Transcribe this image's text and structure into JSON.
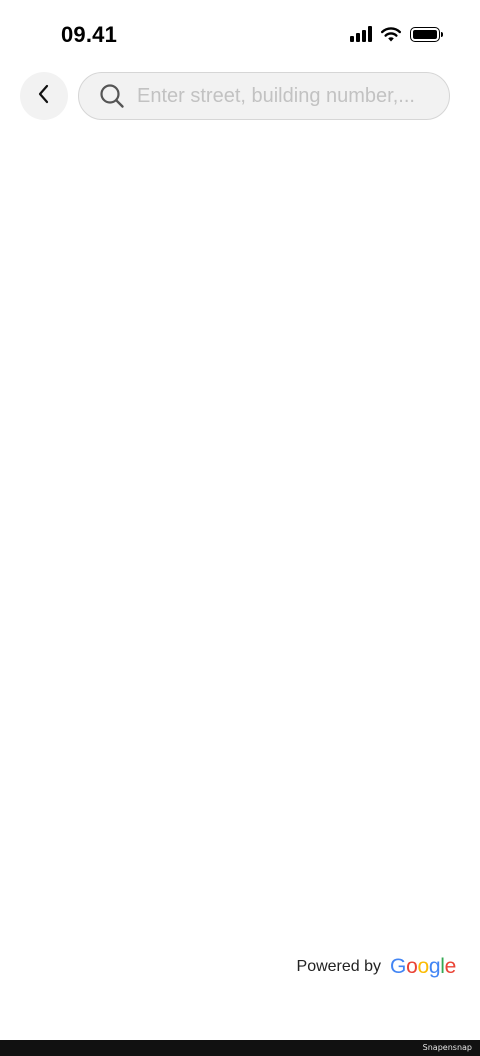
{
  "status_bar": {
    "time": "09.41",
    "icons": [
      "cellular-signal-icon",
      "wifi-icon",
      "battery-icon"
    ]
  },
  "header": {
    "back_icon": "chevron-left-icon",
    "search": {
      "icon": "search-icon",
      "placeholder": "Enter street, building number,...",
      "value": ""
    }
  },
  "footer": {
    "powered_by_label": "Powered by",
    "logo_letters": [
      "G",
      "o",
      "o",
      "g",
      "l",
      "e"
    ],
    "logo_colors": [
      "#4285F4",
      "#EA4335",
      "#FBBC05",
      "#4285F4",
      "#34A853",
      "#EA4335"
    ]
  },
  "watermark": "Snapensnap",
  "colors": {
    "background": "#ffffff",
    "search_background": "#f2f2f2",
    "search_border": "#d6d6d6",
    "placeholder": "#c2c2c2"
  }
}
